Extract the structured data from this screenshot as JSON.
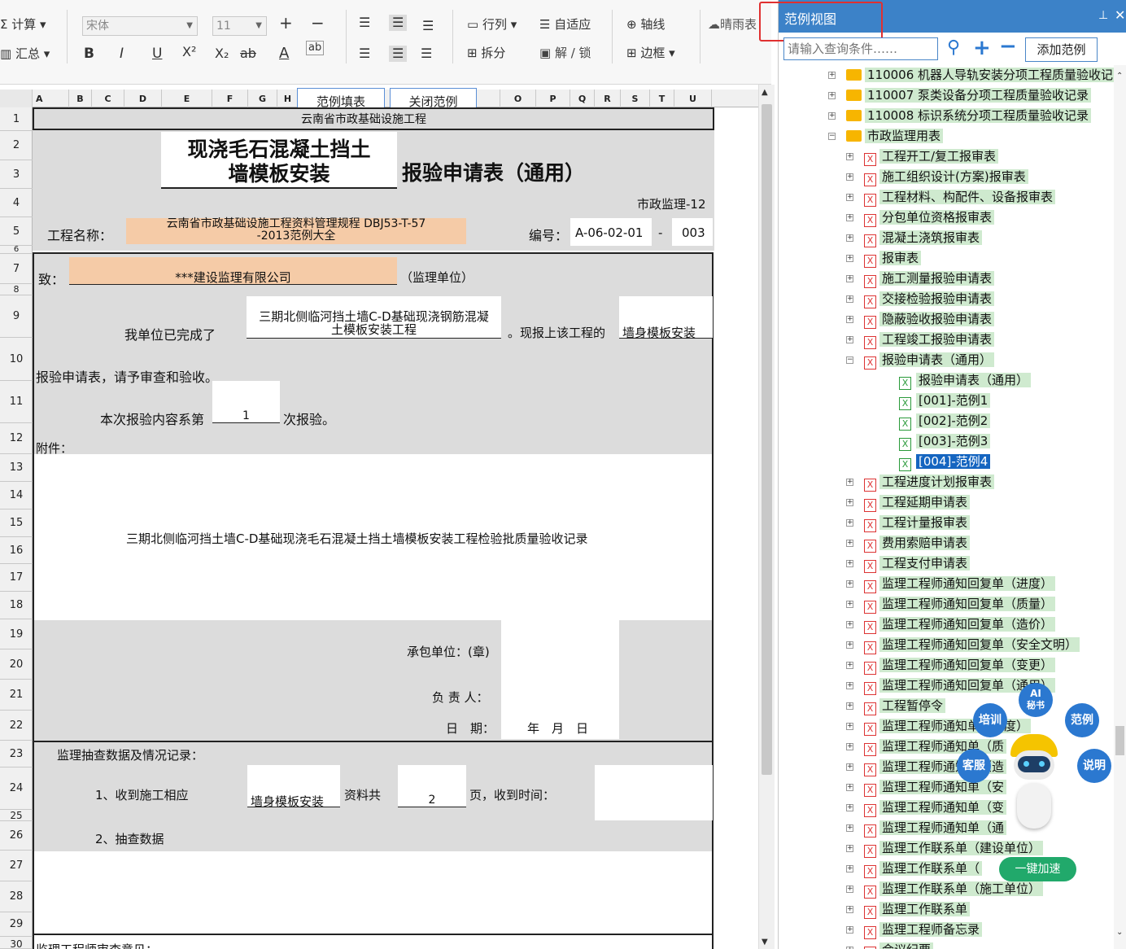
{
  "toolbar": {
    "calc_label": "计算",
    "summary_label": "汇总",
    "font_name": "宋体",
    "font_size": "11",
    "bold": "B",
    "italic": "I",
    "underline": "U",
    "superscript": "X²",
    "subscript": "X₂",
    "strikethrough": "ab",
    "font_color": "A",
    "abc": "ab",
    "rowcol_label": "行列",
    "autofit_label": "自适应",
    "split_label": "拆分",
    "lock_label": "解 / 锁",
    "axis_label": "轴线",
    "border_label": "边框",
    "weather_label": "晴雨表"
  },
  "sheet": {
    "columns": [
      "A",
      "B",
      "C",
      "D",
      "E",
      "F",
      "G",
      "H",
      "O",
      "P",
      "Q",
      "R",
      "S",
      "T",
      "U"
    ],
    "rows": [
      "1",
      "2",
      "3",
      "4",
      "5",
      "6",
      "7",
      "8",
      "9",
      "10",
      "11",
      "12",
      "13",
      "14",
      "15",
      "16",
      "17",
      "18",
      "19",
      "20",
      "21",
      "22",
      "23",
      "24",
      "25",
      "26",
      "27",
      "28",
      "29",
      "30"
    ],
    "fill_example_button": "范例填表",
    "close_example_button": "关闭范例",
    "subtitle": "云南省市政基础设施工程",
    "title_line1": "现浇毛石混凝土挡土",
    "title_line2": "墙模板安装",
    "title_suffix": "报验申请表（通用）",
    "form_code": "市政监理-12",
    "project_name_label": "工程名称：",
    "project_name_line1": "云南省市政基础设施工程资料管理规程 DBJ53-T-57",
    "project_name_line2": "-2013范例大全",
    "number_label": "编号：",
    "number_value": "A-06-02-01",
    "number_dash": "-",
    "number_seq": "003",
    "to_label": "致：",
    "supervisor_company": "***建设监理有限公司",
    "supervisor_unit": "（监理单位）",
    "completed_label": "我单位已完成了",
    "completed_work_line1": "三期北侧临河挡土墙C-D基础现浇钢筋混凝",
    "completed_work_line2": "土模板安装工程",
    "report_label": "。现报上该工程的",
    "report_item": "墙身模板安装",
    "request_text": "报验申请表，请予审查和验收。",
    "times_prefix": "本次报验内容系第",
    "times_value": "1",
    "times_suffix": "次报验。",
    "attachment_label": "附件：",
    "attachment_text": "三期北侧临河挡土墙C-D基础现浇毛石混凝土挡土墙模板安装工程检验批质量验收记录",
    "contractor_label": "承包单位：(章)",
    "responsible_label": "负 责 人：",
    "date_label": "日　期：",
    "date_ymd": "年　月　日",
    "check_record_label": "监理抽查数据及情况记录：",
    "receive_prefix": "1、收到施工相应",
    "receive_item": "墙身模板安装",
    "pages_label": "资料共",
    "pages_value": "2",
    "receive_time_label": "页，收到时间：",
    "sample_data_label": "2、抽查数据",
    "review_label": "监理工程师审查意见："
  },
  "panel": {
    "title": "范例视图",
    "search_placeholder": "请输入查询条件……",
    "add_example_button": "添加范例",
    "tree": [
      {
        "label": "110006 机器人导轨安装分项工程质量验收记",
        "type": "folder"
      },
      {
        "label": "110007 泵类设备分项工程质量验收记录",
        "type": "folder"
      },
      {
        "label": "110008 标识系统分项工程质量验收记录",
        "type": "folder"
      },
      {
        "label": "市政监理用表",
        "type": "folder-open"
      },
      {
        "label": "工程开工/复工报审表",
        "type": "x"
      },
      {
        "label": "施工组织设计(方案)报审表",
        "type": "x"
      },
      {
        "label": "工程材料、构配件、设备报审表",
        "type": "x"
      },
      {
        "label": "分包单位资格报审表",
        "type": "x"
      },
      {
        "label": "混凝土浇筑报审表",
        "type": "x"
      },
      {
        "label": "报审表",
        "type": "x"
      },
      {
        "label": "施工测量报验申请表",
        "type": "x"
      },
      {
        "label": "交接检验报验申请表",
        "type": "x"
      },
      {
        "label": "隐蔽验收报验申请表",
        "type": "x"
      },
      {
        "label": "工程竣工报验申请表",
        "type": "x"
      },
      {
        "label": "报验申请表（通用）",
        "type": "x-open"
      },
      {
        "label": "报验申请表（通用）",
        "type": "child"
      },
      {
        "label": "[001]-范例1",
        "type": "child"
      },
      {
        "label": "[002]-范例2",
        "type": "child"
      },
      {
        "label": "[003]-范例3",
        "type": "child"
      },
      {
        "label": "[004]-范例4",
        "type": "child-selected"
      },
      {
        "label": "工程进度计划报审表",
        "type": "x"
      },
      {
        "label": "工程延期申请表",
        "type": "x"
      },
      {
        "label": "工程计量报审表",
        "type": "x"
      },
      {
        "label": "费用索赔申请表",
        "type": "x"
      },
      {
        "label": "工程支付申请表",
        "type": "x"
      },
      {
        "label": "监理工程师通知回复单（进度）",
        "type": "x"
      },
      {
        "label": "监理工程师通知回复单（质量）",
        "type": "x"
      },
      {
        "label": "监理工程师通知回复单（造价）",
        "type": "x"
      },
      {
        "label": "监理工程师通知回复单（安全文明）",
        "type": "x"
      },
      {
        "label": "监理工程师通知回复单（变更）",
        "type": "x"
      },
      {
        "label": "监理工程师通知回复单（通用）",
        "type": "x"
      },
      {
        "label": "工程暂停令",
        "type": "x"
      },
      {
        "label": "监理工程师通知单（进度）",
        "type": "x"
      },
      {
        "label": "监理工程师通知单（质",
        "type": "x"
      },
      {
        "label": "监理工程师通知单（造",
        "type": "x"
      },
      {
        "label": "监理工程师通知单（安",
        "type": "x"
      },
      {
        "label": "监理工程师通知单（变",
        "type": "x"
      },
      {
        "label": "监理工程师通知单（通",
        "type": "x"
      },
      {
        "label": "监理工作联系单（建设单位）",
        "type": "x"
      },
      {
        "label": "监理工作联系单（",
        "type": "x"
      },
      {
        "label": "监理工作联系单（施工单位）",
        "type": "x"
      },
      {
        "label": "监理工作联系单",
        "type": "x"
      },
      {
        "label": "监理工程师备忘录",
        "type": "x"
      },
      {
        "label": "会议纪要",
        "type": "x"
      }
    ]
  },
  "assistant": {
    "ai_label": "AI",
    "ai_sub": "秘书",
    "training": "培训",
    "examples": "范例",
    "service": "客服",
    "help": "说明",
    "speedup": "一键加速"
  },
  "colors": {
    "accent": "#3c82c8",
    "highlight_border": "#e03030",
    "tree_highlight": "#cfeacf",
    "peach": "#f5cba7"
  }
}
